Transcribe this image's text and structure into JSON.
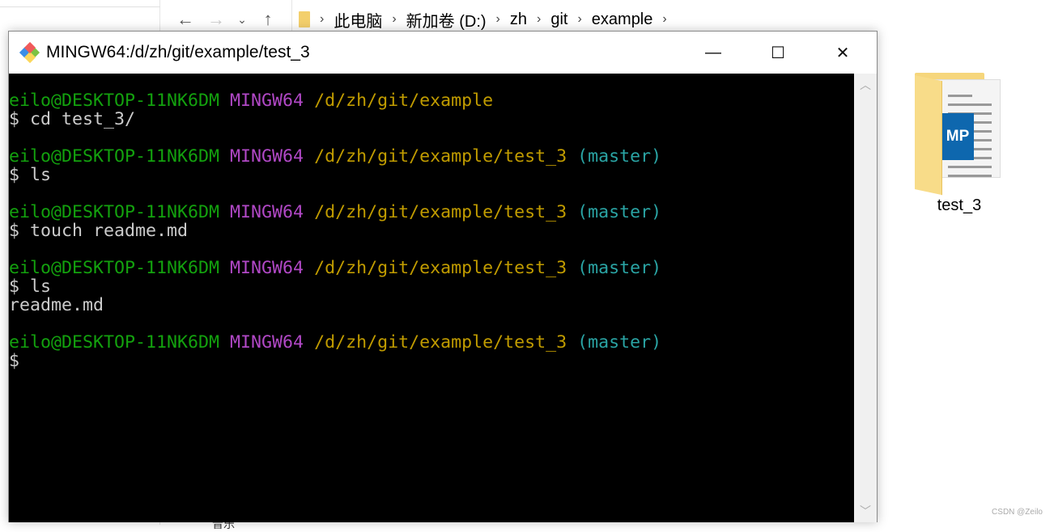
{
  "explorer": {
    "nav": {
      "back": "←",
      "forward": "→",
      "recent": "⌄",
      "up": "↑"
    },
    "breadcrumb": [
      "此电脑",
      "新加卷 (D:)",
      "zh",
      "git",
      "example"
    ],
    "file": {
      "name": "test_3",
      "badge": "MP"
    },
    "taskbar_partial": "音乐",
    "watermark": "CSDN @Zeilo"
  },
  "terminal": {
    "title": "MINGW64:/d/zh/git/example/test_3",
    "controls": {
      "minimize": "—",
      "maximize": "☐",
      "close": "✕"
    },
    "colors": {
      "user": "#13a10e",
      "system": "#b148c6",
      "path": "#c19c00",
      "branch": "#2aa4a4"
    },
    "blocks": [
      {
        "user": "eilo@DESKTOP-11NK6DM",
        "sys": "MINGW64",
        "path": "/d/zh/git/example",
        "branch": "",
        "cmd": "$ cd test_3/",
        "out": ""
      },
      {
        "user": "eilo@DESKTOP-11NK6DM",
        "sys": "MINGW64",
        "path": "/d/zh/git/example/test_3",
        "branch": "(master)",
        "cmd": "$ ls",
        "out": ""
      },
      {
        "user": "eilo@DESKTOP-11NK6DM",
        "sys": "MINGW64",
        "path": "/d/zh/git/example/test_3",
        "branch": "(master)",
        "cmd": "$ touch readme.md",
        "out": ""
      },
      {
        "user": "eilo@DESKTOP-11NK6DM",
        "sys": "MINGW64",
        "path": "/d/zh/git/example/test_3",
        "branch": "(master)",
        "cmd": "$ ls",
        "out": "readme.md"
      },
      {
        "user": "eilo@DESKTOP-11NK6DM",
        "sys": "MINGW64",
        "path": "/d/zh/git/example/test_3",
        "branch": "(master)",
        "cmd": "$",
        "out": ""
      }
    ]
  }
}
